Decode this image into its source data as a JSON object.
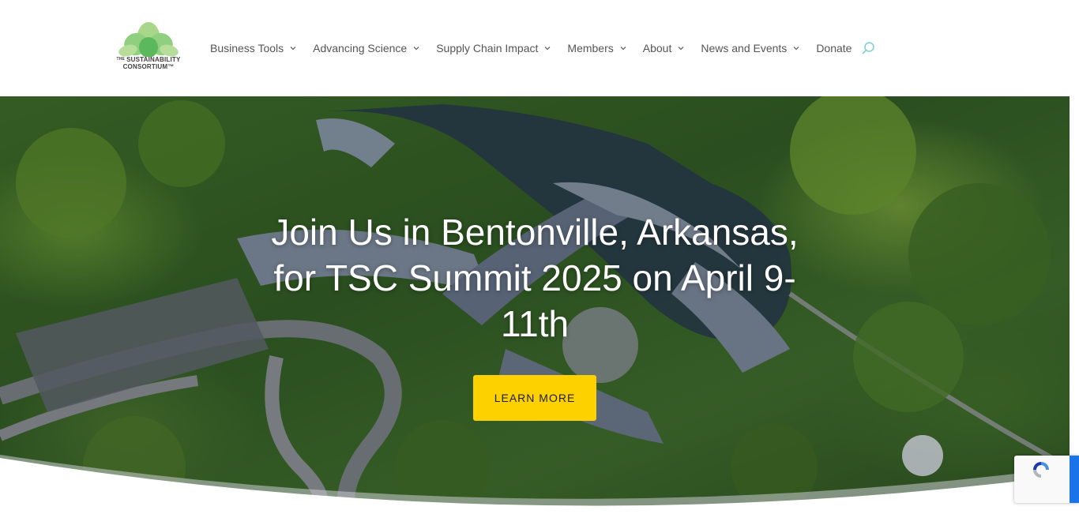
{
  "header": {
    "logo": {
      "small_text": "THE",
      "line1": "SUSTAINABILITY",
      "line2": "CONSORTIUM™"
    },
    "nav": [
      {
        "label": "Business Tools",
        "has_dropdown": true
      },
      {
        "label": "Advancing Science",
        "has_dropdown": true
      },
      {
        "label": "Supply Chain Impact",
        "has_dropdown": true
      },
      {
        "label": "Members",
        "has_dropdown": true
      },
      {
        "label": "About",
        "has_dropdown": true
      },
      {
        "label": "News and Events",
        "has_dropdown": true
      },
      {
        "label": "Donate",
        "has_dropdown": false
      }
    ],
    "search_icon": "search-icon"
  },
  "hero": {
    "heading": "Join Us in Bentonville, Arkansas, for TSC Summit 2025 on April 9-11th",
    "button_label": "LEARN MORE"
  },
  "colors": {
    "accent_yellow": "#fdd000",
    "logo_green_light": "#a8d68a",
    "logo_green": "#6abf69",
    "nav_text": "#555555",
    "search_icon": "#7ccfd0"
  }
}
